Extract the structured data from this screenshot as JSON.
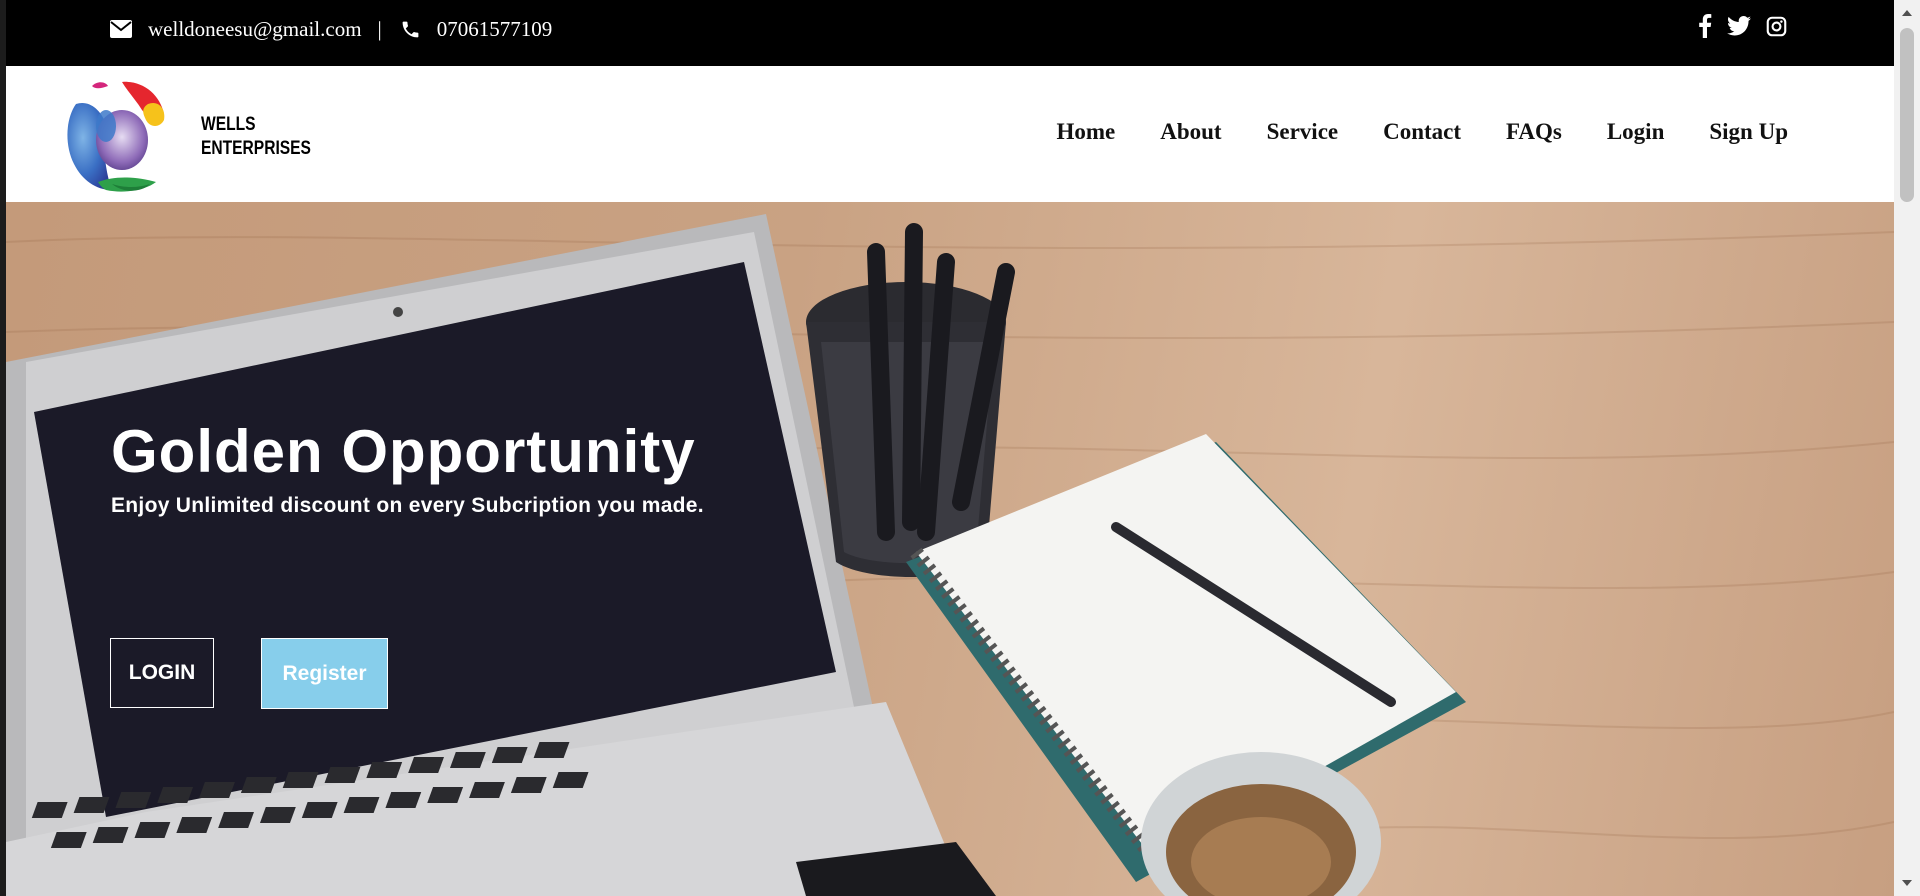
{
  "topbar": {
    "email": "welldoneesu@gmail.com",
    "separator": "|",
    "phone": "07061577109",
    "icons": [
      "envelope-icon",
      "phone-icon",
      "facebook-icon",
      "twitter-icon",
      "instagram-icon"
    ]
  },
  "brand": {
    "line1": "WELLS",
    "line2": "ENTERPRISES"
  },
  "nav": {
    "items": [
      {
        "label": "Home"
      },
      {
        "label": "About"
      },
      {
        "label": "Service"
      },
      {
        "label": "Contact"
      },
      {
        "label": "FAQs"
      },
      {
        "label": "Login"
      },
      {
        "label": "Sign Up"
      }
    ]
  },
  "hero": {
    "title": "Golden Opportunity",
    "subtitle": "Enjoy Unlimited discount on every Subcription you made.",
    "login_label": "LOGIN",
    "register_label": "Register"
  },
  "colors": {
    "topbar_bg": "#000000",
    "register_bg": "#87ceeb",
    "hero_text": "#ffffff"
  }
}
